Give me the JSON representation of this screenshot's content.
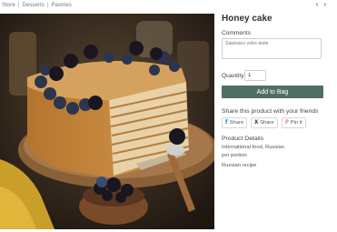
{
  "breadcrumb": {
    "items": [
      "Store",
      "Desserts",
      "Pastries"
    ],
    "separator": "|"
  },
  "pager": {
    "prev_icon": "chevron-left",
    "next_icon": "chevron-right",
    "prev": "‹",
    "next": "›"
  },
  "product": {
    "title": "Honey cake",
    "comments_label": "Comments",
    "comments_placeholder": "Saisissez votre texte",
    "quantity_label": "Quantity:",
    "quantity_value": "1",
    "add_button": "Add to Bag",
    "share_title": "Share this product with your friends",
    "share_buttons": [
      {
        "icon": "facebook-icon",
        "glyph": "f",
        "label": "Share"
      },
      {
        "icon": "x-icon",
        "glyph": "X",
        "label": "Share"
      },
      {
        "icon": "pinterest-icon",
        "glyph": "ℙ",
        "label": "Pin it"
      }
    ],
    "details_title": "Product Details",
    "details_lines": [
      "International food, Russian",
      "per portion"
    ],
    "details_extra": "Russian recipe"
  },
  "colors": {
    "accent": "#4f6f64",
    "facebook": "#1877f2",
    "pinterest": "#cb2027"
  },
  "image": {
    "description_icon": "product-photo"
  }
}
